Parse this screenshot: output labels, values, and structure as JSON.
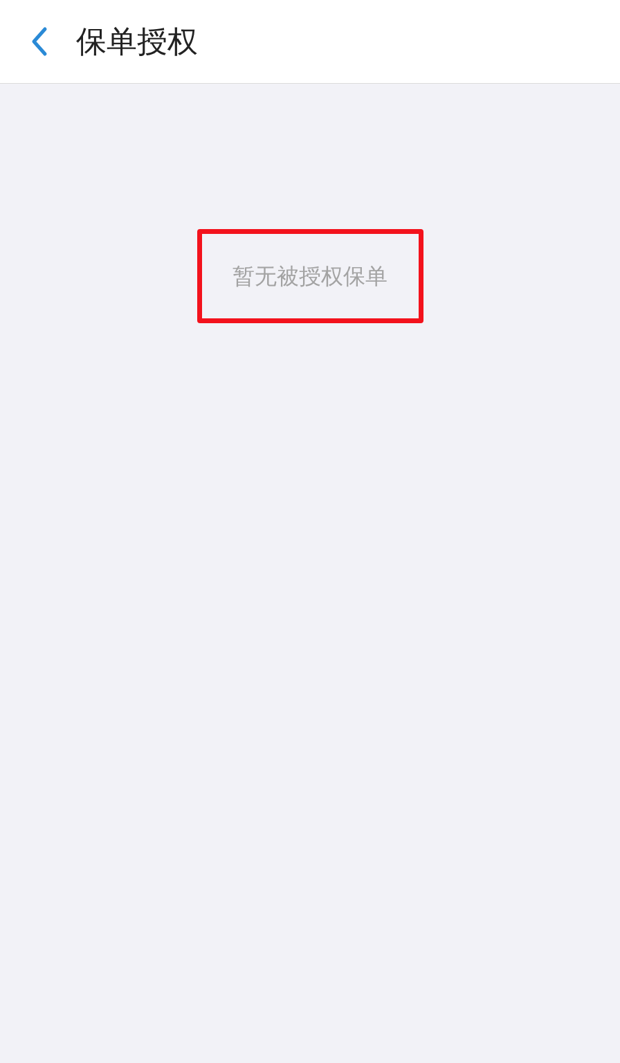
{
  "header": {
    "title": "保单授权"
  },
  "empty_state": {
    "message": "暂无被授权保单",
    "highlighted": true
  }
}
